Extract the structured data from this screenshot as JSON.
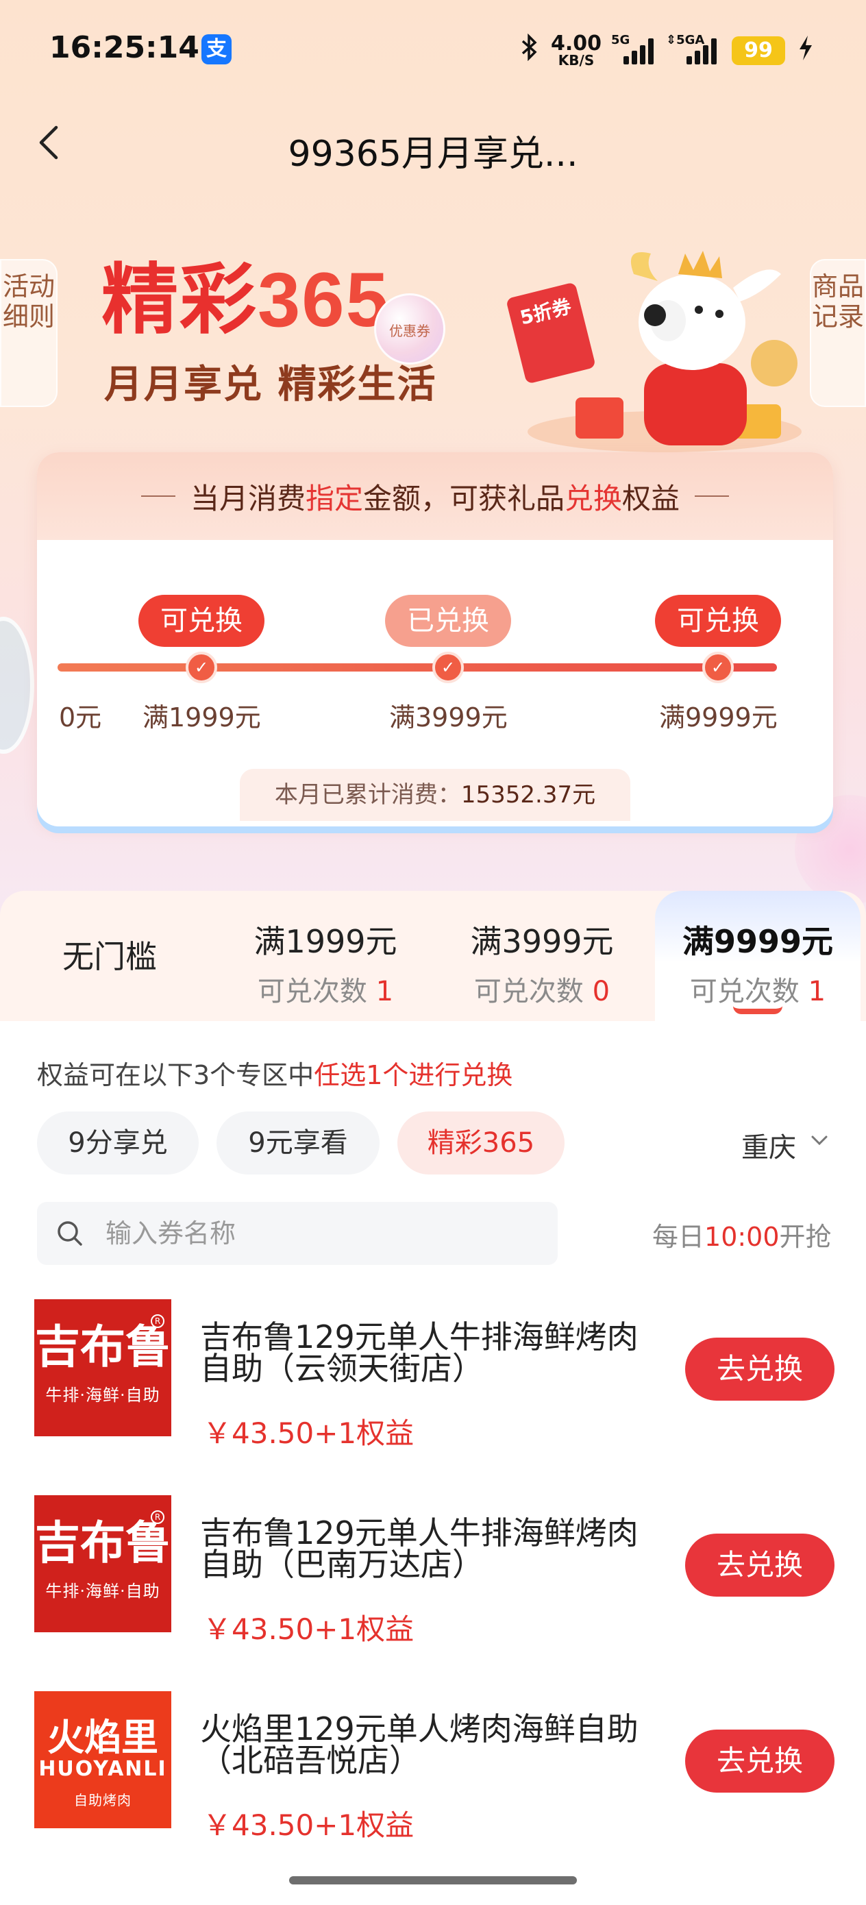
{
  "status_bar": {
    "time": "16:25:14",
    "alipay_glyph": "支",
    "net_speed_value": "4.00",
    "net_speed_unit": "KB/S",
    "sig1_tag": "5G",
    "sig2_tag": "⇕5GA",
    "battery": "99"
  },
  "nav": {
    "title": "99365月月享兑..."
  },
  "side_tabs": {
    "left": "活动细则",
    "right": "商品记录"
  },
  "hero": {
    "brand_prefix": "精彩",
    "brand_number": "365",
    "coupon_bubble": "优惠券",
    "subtitle": "月月享兑 精彩生活",
    "mascot_coupon": "5折券"
  },
  "progress_card": {
    "header_parts": [
      "当月消费",
      "指定",
      "金额，可获礼品",
      "兑换",
      "权益"
    ],
    "start_label": "0元",
    "milestones": [
      {
        "status": "可兑换",
        "label": "满1999元",
        "state": "available"
      },
      {
        "status": "已兑换",
        "label": "满3999元",
        "state": "redeemed"
      },
      {
        "status": "可兑换",
        "label": "满9999元",
        "state": "available"
      }
    ],
    "spent_label": "本月已累计消费：",
    "spent_value": "15352.37元"
  },
  "tiers": [
    {
      "title": "无门槛",
      "count_label": "",
      "count": ""
    },
    {
      "title": "满1999元",
      "count_label": "可兑次数 ",
      "count": "1"
    },
    {
      "title": "满3999元",
      "count_label": "可兑次数 ",
      "count": "0"
    },
    {
      "title": "满9999元",
      "count_label": "可兑次数 ",
      "count": "1",
      "active": true
    }
  ],
  "hint": {
    "prefix": "权益可在以下3个专区中",
    "highlight": "任选1个进行兑换"
  },
  "zones": [
    "9分享兑",
    "9元享看",
    "精彩365"
  ],
  "active_zone": "精彩365",
  "city": "重庆",
  "search": {
    "placeholder": "输入券名称",
    "value": ""
  },
  "daily": {
    "prefix": "每日",
    "time": "10:00",
    "suffix": "开抢"
  },
  "items": [
    {
      "logo": "吉布鲁",
      "logo_sub": "牛排·海鲜·自助",
      "title": "吉布鲁129元单人牛排海鲜烤肉自助（云领天街店）",
      "price": "￥43.50+1权益",
      "button": "去兑换"
    },
    {
      "logo": "吉布鲁",
      "logo_sub": "牛排·海鲜·自助",
      "title": "吉布鲁129元单人牛排海鲜烤肉自助（巴南万达店）",
      "price": "￥43.50+1权益",
      "button": "去兑换"
    },
    {
      "logo": "火焰里",
      "logo_en": "HUOYANLI",
      "logo_sub": "自助烤肉",
      "title": "火焰里129元单人烤肉海鲜自助（北碚吾悦店）",
      "price": "￥43.50+1权益",
      "button": "去兑换"
    }
  ],
  "colors": {
    "accent_red": "#e5322d",
    "button_red": "#e8353b",
    "brand_blue": "#1677ff"
  },
  "icons": [
    "bluetooth-icon",
    "signal-icon",
    "battery-icon",
    "charging-icon",
    "back-arrow-icon",
    "check-icon",
    "search-icon",
    "chevron-down-icon"
  ]
}
